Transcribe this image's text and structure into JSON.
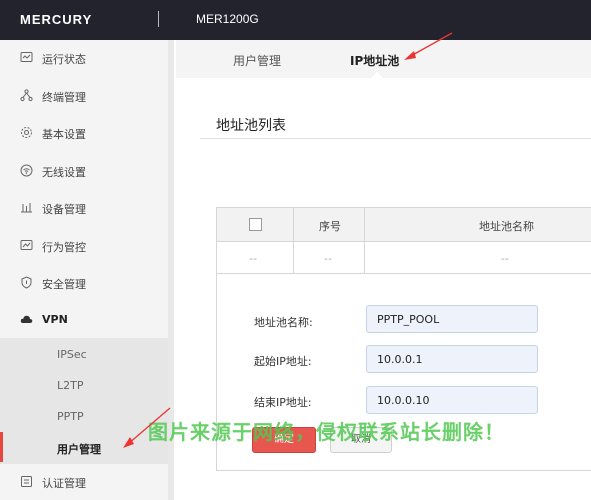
{
  "header": {
    "brand": "MERCURY",
    "model": "MER1200G"
  },
  "sidebar": {
    "items": [
      {
        "label": "运行状态",
        "icon": "monitor-icon"
      },
      {
        "label": "终端管理",
        "icon": "network-icon"
      },
      {
        "label": "基本设置",
        "icon": "gear-icon"
      },
      {
        "label": "无线设置",
        "icon": "wifi-icon"
      },
      {
        "label": "设备管理",
        "icon": "device-icon"
      },
      {
        "label": "行为管控",
        "icon": "behavior-icon"
      },
      {
        "label": "安全管理",
        "icon": "shield-icon"
      },
      {
        "label": "VPN",
        "icon": "cloud-icon"
      }
    ],
    "vpn_sub": [
      "IPSec",
      "L2TP",
      "PPTP",
      "用户管理"
    ],
    "bottom_item": {
      "label": "认证管理",
      "icon": "auth-icon"
    }
  },
  "tabs": {
    "users": "用户管理",
    "ip_pool": "IP地址池"
  },
  "section": {
    "title": "地址池列表"
  },
  "table": {
    "headers": {
      "index": "序号",
      "name": "地址池名称"
    },
    "empty_row": {
      "index": "--",
      "col0": "--",
      "name": "--"
    }
  },
  "form": {
    "pool_name_label": "地址池名称:",
    "pool_name_value": "PPTP_POOL",
    "start_ip_label": "起始IP地址:",
    "start_ip_value": "10.0.0.1",
    "end_ip_label": "结束IP地址:",
    "end_ip_value": "10.0.0.10"
  },
  "buttons": {
    "ok": "确定",
    "cancel": "取消"
  },
  "watermark": "图片来源于网络，侵权联系站长删除！",
  "colors": {
    "accent": "#e8574f",
    "topbar": "#23232e",
    "watermark": "#50c850"
  }
}
